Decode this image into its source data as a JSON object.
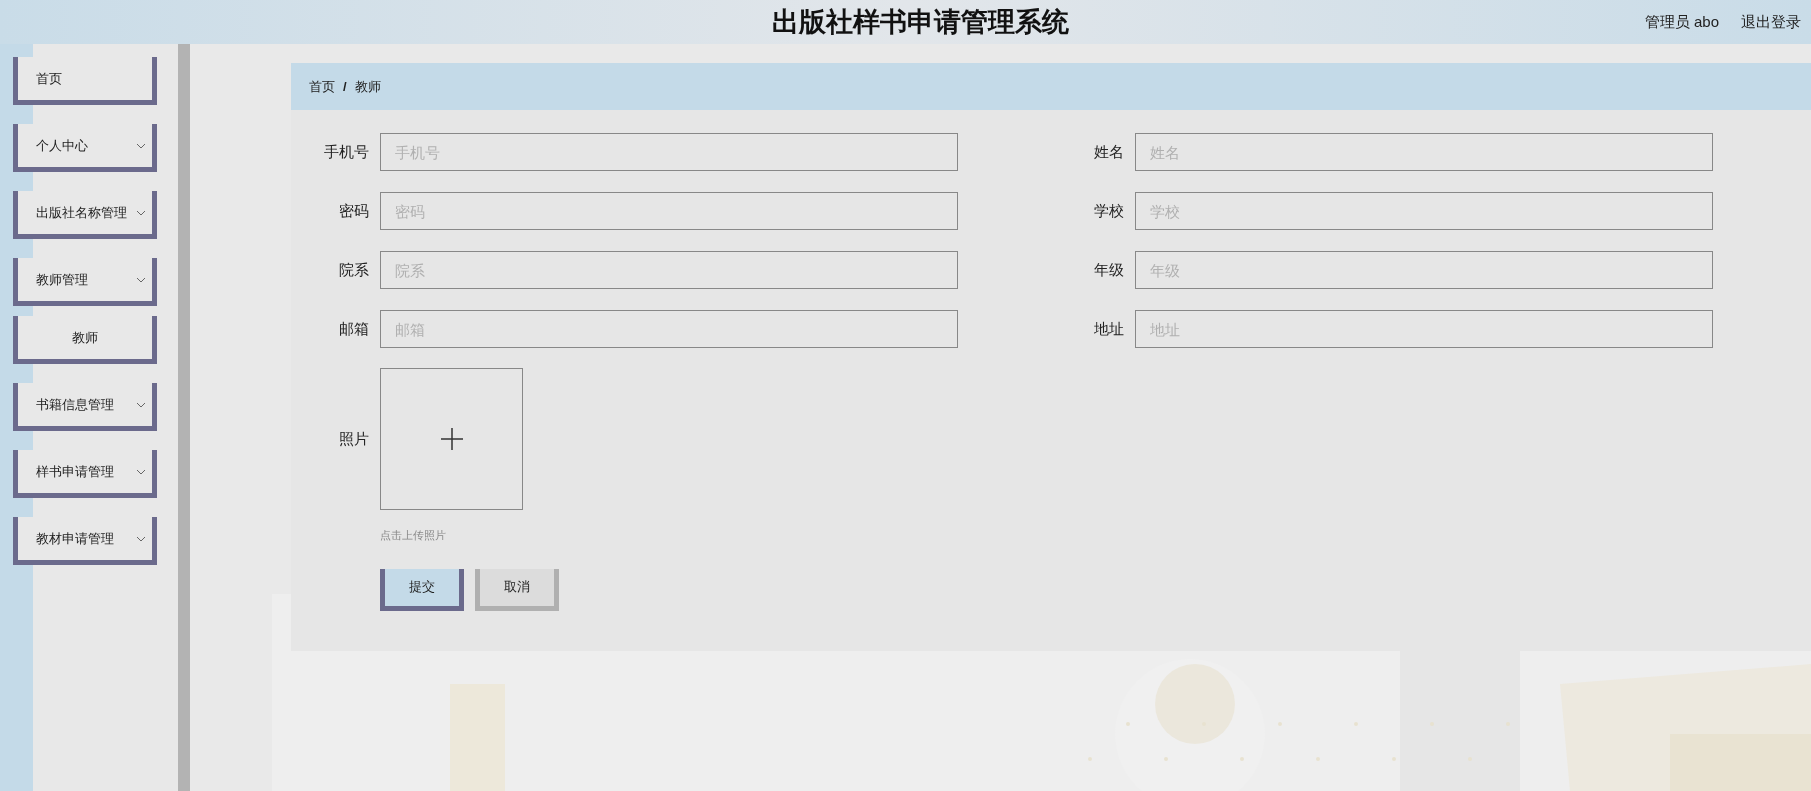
{
  "header": {
    "title": "出版社样书申请管理系统",
    "user": "管理员 abo",
    "logout": "退出登录"
  },
  "sidebar": {
    "items": [
      {
        "label": "首页",
        "kind": "link"
      },
      {
        "label": "个人中心",
        "kind": "menu"
      },
      {
        "label": "出版社名称管理",
        "kind": "menu"
      },
      {
        "label": "教师管理",
        "kind": "menu",
        "children": [
          {
            "label": "教师"
          }
        ]
      },
      {
        "label": "书籍信息管理",
        "kind": "menu"
      },
      {
        "label": "样书申请管理",
        "kind": "menu"
      },
      {
        "label": "教材申请管理",
        "kind": "menu"
      }
    ]
  },
  "breadcrumb": [
    "首页",
    "/",
    "教师"
  ],
  "form": {
    "fields": [
      {
        "label": "手机号",
        "placeholder": "手机号"
      },
      {
        "label": "姓名",
        "placeholder": "姓名"
      },
      {
        "label": "密码",
        "placeholder": "密码"
      },
      {
        "label": "学校",
        "placeholder": "学校"
      },
      {
        "label": "院系",
        "placeholder": "院系"
      },
      {
        "label": "年级",
        "placeholder": "年级"
      },
      {
        "label": "邮箱",
        "placeholder": "邮箱"
      },
      {
        "label": "地址",
        "placeholder": "地址"
      }
    ],
    "photo": {
      "label": "照片",
      "hint": "点击上传照片"
    },
    "buttons": [
      {
        "label": "提交",
        "kind": "primary"
      },
      {
        "label": "取消",
        "kind": "secondary"
      }
    ]
  }
}
